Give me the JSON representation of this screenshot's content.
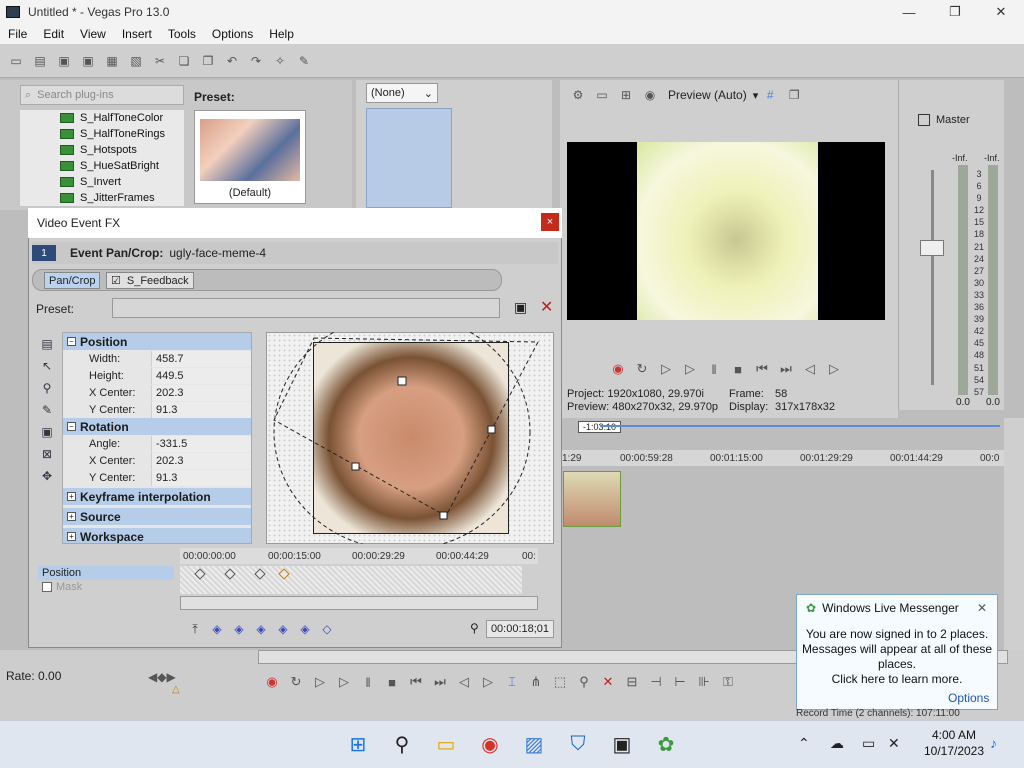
{
  "window": {
    "title": "Untitled * - Vegas Pro 13.0",
    "minimize": "—",
    "restore": "❐",
    "close": "✕"
  },
  "menu": [
    "File",
    "Edit",
    "View",
    "Insert",
    "Tools",
    "Options",
    "Help"
  ],
  "plugins": {
    "search_placeholder": "Search plug-ins",
    "items": [
      "S_HalfToneColor",
      "S_HalfToneRings",
      "S_Hotspots",
      "S_HueSatBright",
      "S_Invert",
      "S_JitterFrames"
    ],
    "preset_label": "Preset:",
    "preset_default": "(Default)"
  },
  "transitions": {
    "select_value": "(None)"
  },
  "preview": {
    "mode": "Preview (Auto)",
    "project": "Project:  1920x1080, 29.970i",
    "frame_label": "Frame:",
    "frame_value": "58",
    "preview_line": "Preview:  480x270x32, 29.970p",
    "display_label": "Display:",
    "display_value": "317x178x32"
  },
  "master": {
    "title": "Master",
    "inf_left": "-Inf.",
    "inf_right": "-Inf.",
    "scale": [
      "3",
      "6",
      "9",
      "12",
      "15",
      "18",
      "21",
      "24",
      "27",
      "30",
      "33",
      "36",
      "39",
      "42",
      "45",
      "48",
      "51",
      "54",
      "57"
    ],
    "level_left": "0.0",
    "level_right": "0.0"
  },
  "timeline": {
    "cursor_time": "-1:03:10",
    "ruler": [
      "1:29",
      "00:00:59:28",
      "00:01:15:00",
      "00:01:29:29",
      "00:01:44:29",
      "00:0"
    ]
  },
  "vfx": {
    "title": "Video Event FX",
    "close": "×",
    "badge": "1",
    "event_label": "Event Pan/Crop:",
    "event_name": "ugly-face-meme-4",
    "chip_pancrop": "Pan/Crop",
    "chip_feedback": "S_Feedback",
    "preset_label": "Preset:",
    "groups": {
      "position": "Position",
      "rotation": "Rotation",
      "keyframe": "Keyframe interpolation",
      "source": "Source",
      "workspace": "Workspace"
    },
    "position_rows": [
      {
        "k": "Width:",
        "v": "458.7"
      },
      {
        "k": "Height:",
        "v": "449.5"
      },
      {
        "k": "X Center:",
        "v": "202.3"
      },
      {
        "k": "Y Center:",
        "v": "91.3"
      }
    ],
    "rotation_rows": [
      {
        "k": "Angle:",
        "v": "-331.5"
      },
      {
        "k": "X Center:",
        "v": "202.3"
      },
      {
        "k": "Y Center:",
        "v": "91.3"
      }
    ],
    "kf_ruler": [
      "00:00:00:00",
      "00:00:15:00",
      "00:00:29:29",
      "00:00:44:29",
      "00:"
    ],
    "kf_labels": [
      "Position",
      "Mask"
    ],
    "kf_time": "00:00:18;01"
  },
  "transport": {
    "rate": "Rate: 0.00"
  },
  "messenger": {
    "title": "Windows Live Messenger",
    "body": "You are now signed in to 2 places. Messages will appear at all of these places.",
    "cta": "Click here to learn more.",
    "options": "Options",
    "close": "✕",
    "status": "Record Time (2 channels): 107:11:00"
  },
  "taskbar": {
    "time": "4:00 AM",
    "date": "10/17/2023"
  },
  "colors": {
    "accent": "#2d4a7a",
    "group": "#b6cdea",
    "close": "#c42b1c"
  }
}
